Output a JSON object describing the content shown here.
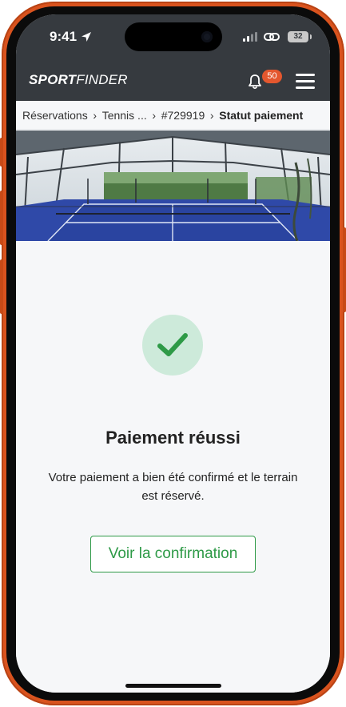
{
  "status_bar": {
    "time": "9:41",
    "battery": "32",
    "icons": [
      "location-arrow-icon",
      "signal-icon",
      "link-icon",
      "battery-icon"
    ]
  },
  "header": {
    "logo_bold": "SPORT",
    "logo_regular": "FINDER",
    "notification_count": "50",
    "icons": [
      "bell-icon",
      "hamburger-menu-icon"
    ]
  },
  "breadcrumb": {
    "items": [
      "Réservations",
      "Tennis ...",
      "#729919"
    ],
    "current": "Statut paiement"
  },
  "hero": {
    "image": "padel-court-photo"
  },
  "main": {
    "status_icon": "checkmark-icon",
    "title": "Paiement réussi",
    "message": "Votre paiement a bien été confirmé et le terrain est réservé.",
    "button_label": "Voir la confirmation"
  },
  "colors": {
    "header_bg": "#363a3f",
    "accent_green": "#2e9a47",
    "success_circle": "#cdeada",
    "badge": "#e4572e",
    "phone_frame": "#d9531e"
  }
}
